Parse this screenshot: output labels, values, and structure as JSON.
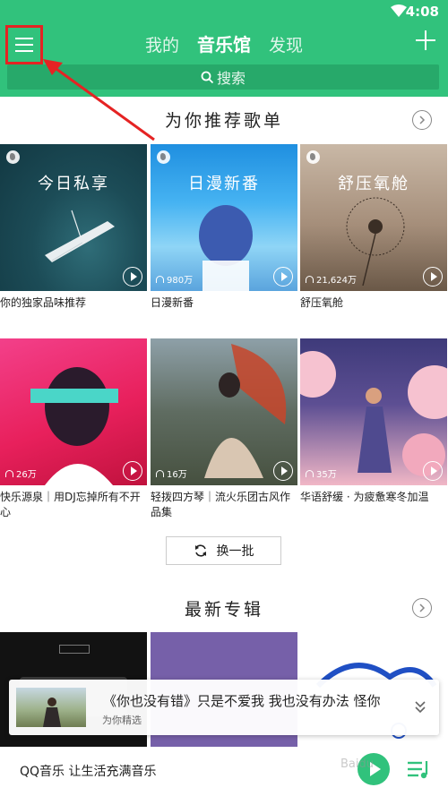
{
  "status": {
    "time": "4:08"
  },
  "header": {
    "tabs": [
      "我的",
      "音乐馆",
      "发现"
    ],
    "active_tab": "音乐馆",
    "search_placeholder": "搜索",
    "accent": "#31c27c"
  },
  "recommend": {
    "title": "为你推荐歌单",
    "items": [
      {
        "cover_title": "今日私享",
        "plays": "",
        "label": "你的独家品味推荐"
      },
      {
        "cover_title": "日漫新番",
        "plays": "980万",
        "label": "日漫新番"
      },
      {
        "cover_title": "舒压氧舱",
        "plays": "21,624万",
        "label": "舒压氧舱"
      },
      {
        "cover_title": "",
        "plays": "26万",
        "label": "快乐源泉｜用DJ忘掉所有不开心"
      },
      {
        "cover_title": "",
        "plays": "16万",
        "label": "轻拨四方琴｜流火乐团古风作品集"
      },
      {
        "cover_title": "",
        "plays": "35万",
        "label": "华语舒缓 · 为疲惫寒冬加温"
      }
    ],
    "refresh_label": "换一批"
  },
  "albums": {
    "title": "最新专辑"
  },
  "mini_player": {
    "song": "《你也没有错》只是不爱我 我也没有办法 怪你",
    "subtitle": "为你精选"
  },
  "bottom_bar": {
    "slogan": "QQ音乐 让生活充满音乐"
  },
  "watermark": "Baidu"
}
